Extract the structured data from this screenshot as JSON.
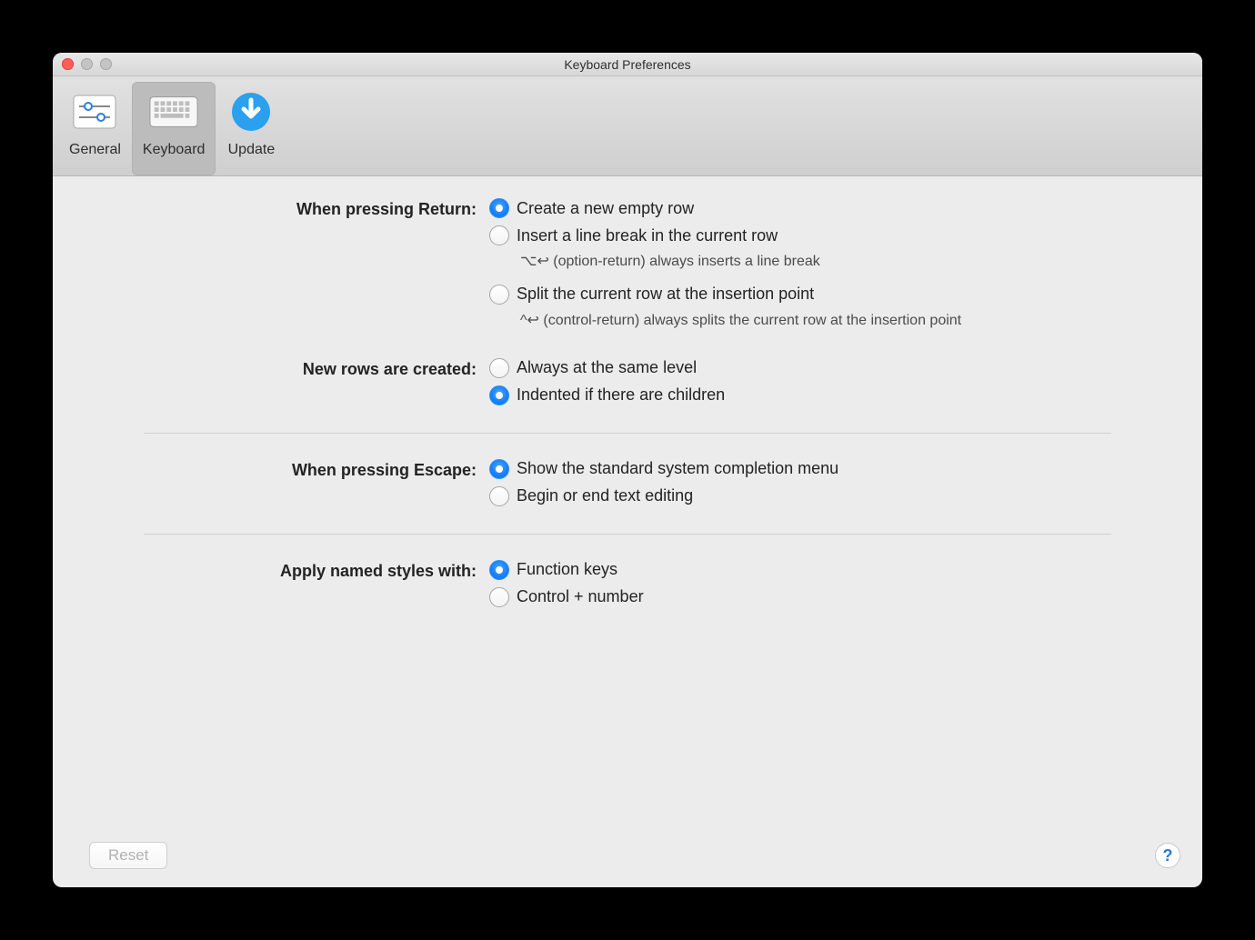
{
  "window": {
    "title": "Keyboard Preferences"
  },
  "toolbar": {
    "items": [
      {
        "label": "General",
        "selected": false,
        "name": "tool-general"
      },
      {
        "label": "Keyboard",
        "selected": true,
        "name": "tool-keyboard"
      },
      {
        "label": "Update",
        "selected": false,
        "name": "tool-update"
      }
    ]
  },
  "sections": {
    "return": {
      "label": "When pressing Return:",
      "options": [
        {
          "label": "Create a new empty row",
          "checked": true
        },
        {
          "label": "Insert a line break in the current row",
          "checked": false,
          "hint": "⌥↩ (option-return) always inserts a line break"
        },
        {
          "label": "Split the current row at the insertion point",
          "checked": false,
          "hint": "^↩ (control-return) always splits the current row at the insertion point"
        }
      ]
    },
    "newrows": {
      "label": "New rows are created:",
      "options": [
        {
          "label": "Always at the same level",
          "checked": false
        },
        {
          "label": "Indented if there are children",
          "checked": true
        }
      ]
    },
    "escape": {
      "label": "When pressing Escape:",
      "options": [
        {
          "label": "Show the standard system completion menu",
          "checked": true
        },
        {
          "label": "Begin or end text editing",
          "checked": false
        }
      ]
    },
    "styles": {
      "label": "Apply named styles with:",
      "options": [
        {
          "label": "Function keys",
          "checked": true
        },
        {
          "label": "Control + number",
          "checked": false
        }
      ]
    }
  },
  "buttons": {
    "reset": "Reset",
    "help": "?"
  }
}
